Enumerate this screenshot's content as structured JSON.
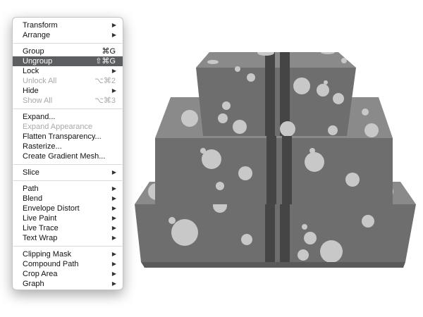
{
  "canvas": {
    "cake_color": "#6e6e6e",
    "cake_top_color": "#8a8a8a",
    "ribbon_color": "#454545",
    "dot_color": "#c8c8c8"
  },
  "menu": {
    "selected_bg": "#5c5e62",
    "groups": [
      [
        {
          "label": "Transform",
          "submenu": true
        },
        {
          "label": "Arrange",
          "submenu": true
        }
      ],
      [
        {
          "label": "Group",
          "shortcut": "⌘G"
        },
        {
          "label": "Ungroup",
          "shortcut": "⇧⌘G",
          "selected": true
        },
        {
          "label": "Lock",
          "submenu": true
        },
        {
          "label": "Unlock All",
          "shortcut": "⌥⌘2",
          "disabled": true
        },
        {
          "label": "Hide",
          "submenu": true
        },
        {
          "label": "Show All",
          "shortcut": "⌥⌘3",
          "disabled": true
        }
      ],
      [
        {
          "label": "Expand..."
        },
        {
          "label": "Expand Appearance",
          "disabled": true
        },
        {
          "label": "Flatten Transparency..."
        },
        {
          "label": "Rasterize..."
        },
        {
          "label": "Create Gradient Mesh..."
        }
      ],
      [
        {
          "label": "Slice",
          "submenu": true
        }
      ],
      [
        {
          "label": "Path",
          "submenu": true
        },
        {
          "label": "Blend",
          "submenu": true
        },
        {
          "label": "Envelope Distort",
          "submenu": true
        },
        {
          "label": "Live Paint",
          "submenu": true
        },
        {
          "label": "Live Trace",
          "submenu": true
        },
        {
          "label": "Text Wrap",
          "submenu": true
        }
      ],
      [
        {
          "label": "Clipping Mask",
          "submenu": true
        },
        {
          "label": "Compound Path",
          "submenu": true
        },
        {
          "label": "Crop Area",
          "submenu": true
        },
        {
          "label": "Graph",
          "submenu": true
        }
      ]
    ]
  }
}
